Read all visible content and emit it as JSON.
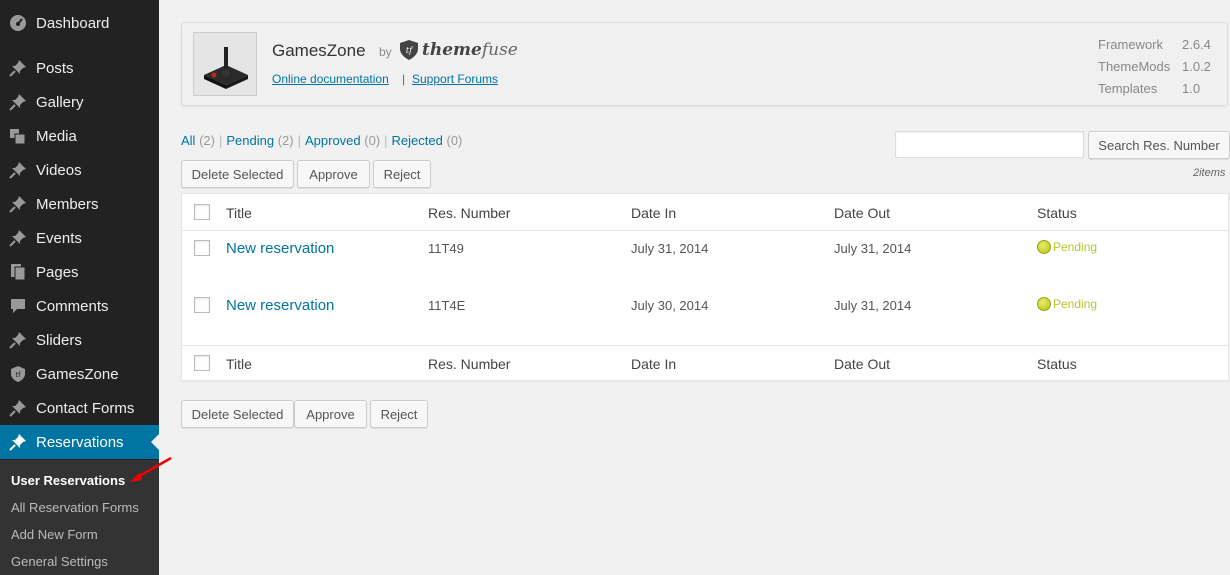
{
  "sidebar": {
    "items": [
      {
        "label": "Dashboard",
        "icon": "dashboard-icon"
      },
      {
        "label": "Posts",
        "icon": "pin-icon"
      },
      {
        "label": "Gallery",
        "icon": "pin-icon"
      },
      {
        "label": "Media",
        "icon": "media-icon"
      },
      {
        "label": "Videos",
        "icon": "pin-icon"
      },
      {
        "label": "Members",
        "icon": "pin-icon"
      },
      {
        "label": "Events",
        "icon": "pin-icon"
      },
      {
        "label": "Pages",
        "icon": "pages-icon"
      },
      {
        "label": "Comments",
        "icon": "comment-icon"
      },
      {
        "label": "Sliders",
        "icon": "pin-icon"
      },
      {
        "label": "GamesZone",
        "icon": "shield-icon"
      },
      {
        "label": "Contact Forms",
        "icon": "pin-icon"
      },
      {
        "label": "Reservations",
        "icon": "pin-icon",
        "active": true
      }
    ],
    "submenu": [
      {
        "label": "User Reservations",
        "current": true
      },
      {
        "label": "All Reservation Forms"
      },
      {
        "label": "Add New Form"
      },
      {
        "label": "General Settings"
      }
    ],
    "active_color": "#0074a2"
  },
  "theme": {
    "name": "GamesZone",
    "by": "by",
    "logo_bold": "theme",
    "logo_light": "fuse",
    "logo_mark": "tf",
    "doc_link": "Online documentation",
    "separator": "|",
    "forum_link": "Support Forums",
    "versions": [
      {
        "label": "Framework",
        "value": "2.6.4"
      },
      {
        "label": "ThemeMods",
        "value": "1.0.2"
      },
      {
        "label": "Templates",
        "value": "1.0"
      }
    ]
  },
  "filters": [
    {
      "label": "All",
      "count": "(2)"
    },
    {
      "label": "Pending",
      "count": "(2)"
    },
    {
      "label": "Approved",
      "count": "(0)"
    },
    {
      "label": "Rejected",
      "count": "(0)"
    }
  ],
  "filter_separator": "|",
  "search": {
    "placeholder": "",
    "button": "Search Res. Number"
  },
  "bulk_actions": {
    "delete": "Delete Selected",
    "approve": "Approve",
    "reject": "Reject"
  },
  "items_count": "2items",
  "table": {
    "columns": [
      "Title",
      "Res. Number",
      "Date In",
      "Date Out",
      "Status"
    ],
    "rows": [
      {
        "title": "New reservation",
        "res_number": "11T49",
        "date_in": "July 31, 2014",
        "date_out": "July 31, 2014",
        "status": "Pending"
      },
      {
        "title": "New reservation",
        "res_number": "11T4E",
        "date_in": "July 30, 2014",
        "date_out": "July 31, 2014",
        "status": "Pending"
      }
    ]
  },
  "colors": {
    "link": "#0074a2",
    "pending": "#b8c430",
    "sidebar_bg": "#222222"
  }
}
